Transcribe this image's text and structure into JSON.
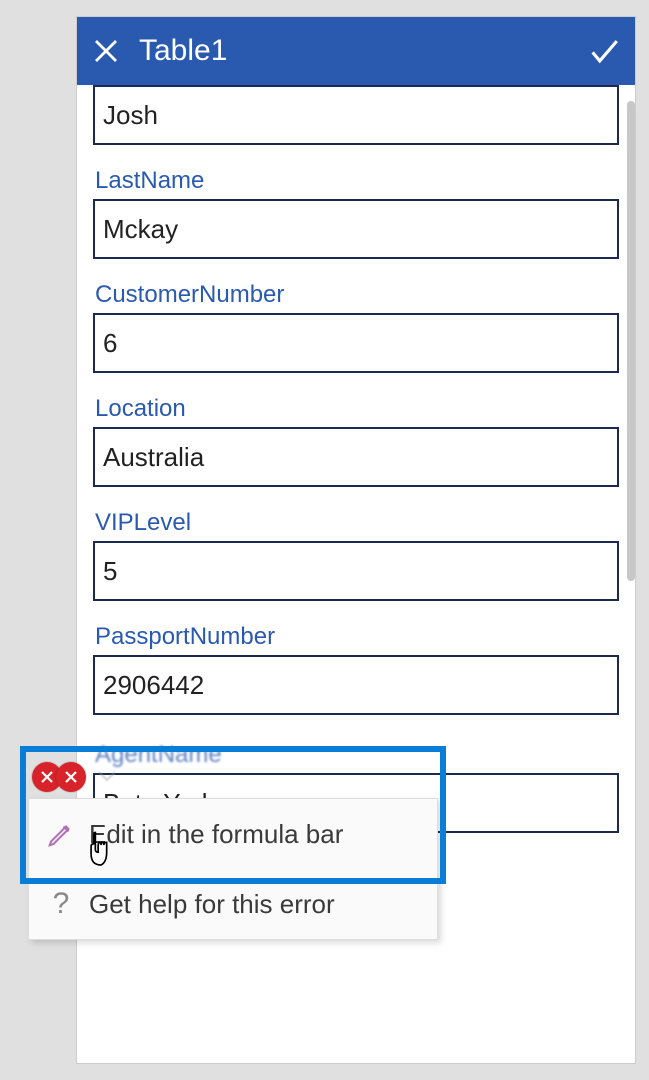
{
  "header": {
    "title": "Table1"
  },
  "form": {
    "fields": [
      {
        "label": "",
        "value": "Josh"
      },
      {
        "label": "LastName",
        "value": "Mckay"
      },
      {
        "label": "CustomerNumber",
        "value": "6"
      },
      {
        "label": "Location",
        "value": "Australia"
      },
      {
        "label": "VIPLevel",
        "value": "5"
      },
      {
        "label": "PassportNumber",
        "value": "2906442"
      }
    ],
    "agentNameLabel": "AgentName",
    "agentNameValue": "Beto Yark"
  },
  "contextMenu": {
    "editFormula": "Edit in the formula bar",
    "getHelp": "Get help for this error"
  }
}
